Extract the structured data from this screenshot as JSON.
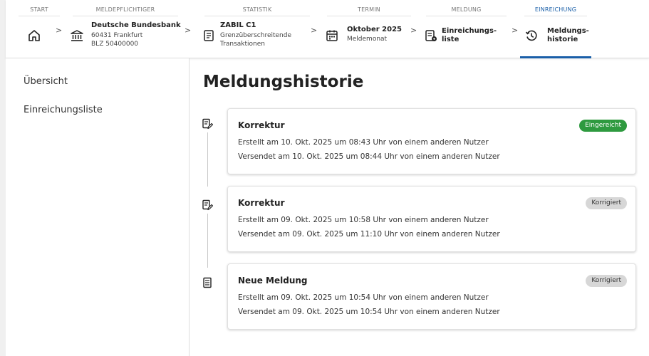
{
  "header": {
    "steps": [
      {
        "caption": "START",
        "icon": "home-icon"
      },
      {
        "caption": "MELDEPFLICHTIGER",
        "title": "Deutsche Bundesbank",
        "sub1": "60431 Frankfurt",
        "sub2": "BLZ 50400000",
        "icon": "bank-icon"
      },
      {
        "caption": "STATISTIK",
        "title": "ZABIL C1",
        "sub1": "Grenzüberschreitende",
        "sub2": "Transaktionen",
        "icon": "form-icon"
      },
      {
        "caption": "TERMIN",
        "title": "Oktober 2025",
        "sub1": "Meldemonat",
        "icon": "calendar-icon"
      },
      {
        "caption": "MELDUNG",
        "title1": "Einreichungs-",
        "title2": "liste",
        "icon": "list-settings-icon"
      },
      {
        "caption": "EINREICHUNG",
        "title1": "Meldungs-",
        "title2": "historie",
        "icon": "history-icon"
      }
    ]
  },
  "sidebar": {
    "items": [
      {
        "label": "Übersicht"
      },
      {
        "label": "Einreichungsliste"
      }
    ]
  },
  "main": {
    "title": "Meldungshistorie",
    "entries": [
      {
        "title": "Korrektur",
        "status": "Eingereicht",
        "line1": "Erstellt am 10. Okt. 2025 um 08:43 Uhr von einem anderen Nutzer",
        "line2": "Versendet am 10. Okt. 2025 um 08:44 Uhr von einem anderen Nutzer",
        "icon": "edit-document-icon"
      },
      {
        "title": "Korrektur",
        "status": "Korrigiert",
        "line1": "Erstellt am 09. Okt. 2025 um 10:58 Uhr von einem anderen Nutzer",
        "line2": "Versendet am 09. Okt. 2025 um 11:10 Uhr von einem anderen Nutzer",
        "icon": "edit-document-icon"
      },
      {
        "title": "Neue Meldung",
        "status": "Korrigiert",
        "line1": "Erstellt am 09. Okt. 2025 um 10:54 Uhr von einem anderen Nutzer",
        "line2": "Versendet am 09. Okt. 2025 um 10:54 Uhr von einem anderen Nutzer",
        "icon": "document-icon"
      }
    ]
  },
  "colors": {
    "accent": "#1a5fa8",
    "status_green": "#2e9a3f",
    "status_gray": "#d7d7d7"
  }
}
